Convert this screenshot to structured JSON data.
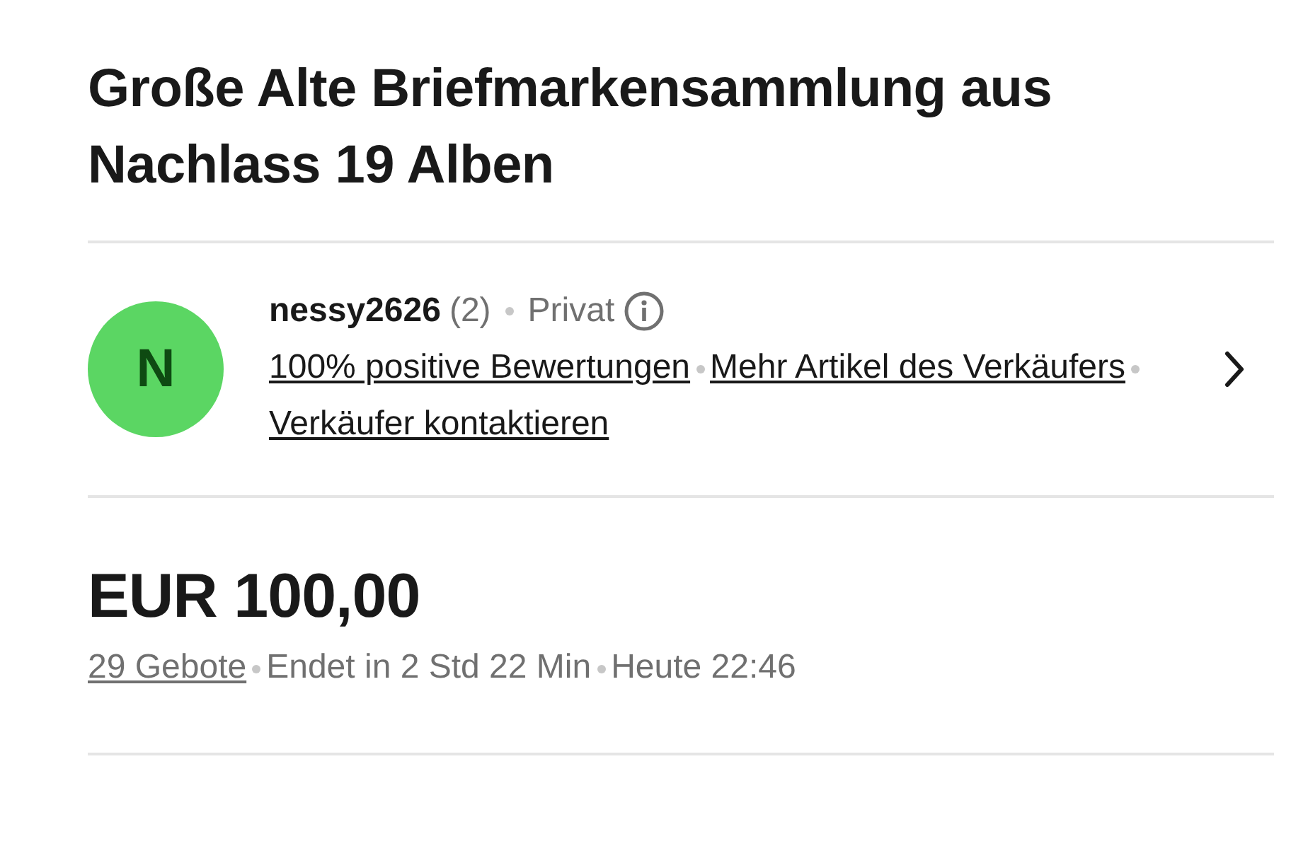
{
  "title": "Große Alte Briefmarkensammlung aus Nachlass 19 Alben",
  "seller": {
    "avatar_letter": "N",
    "name": "nessy2626",
    "rating_count": "(2)",
    "type": "Privat",
    "links": [
      "100% positive Bewertungen",
      "Mehr Artikel des Verkäufers",
      "Verkäufer kontaktieren"
    ]
  },
  "price": "EUR 100,00",
  "bids": "29 Gebote",
  "ends_in": "Endet in 2 Std 22 Min",
  "end_time": "Heute 22:46"
}
